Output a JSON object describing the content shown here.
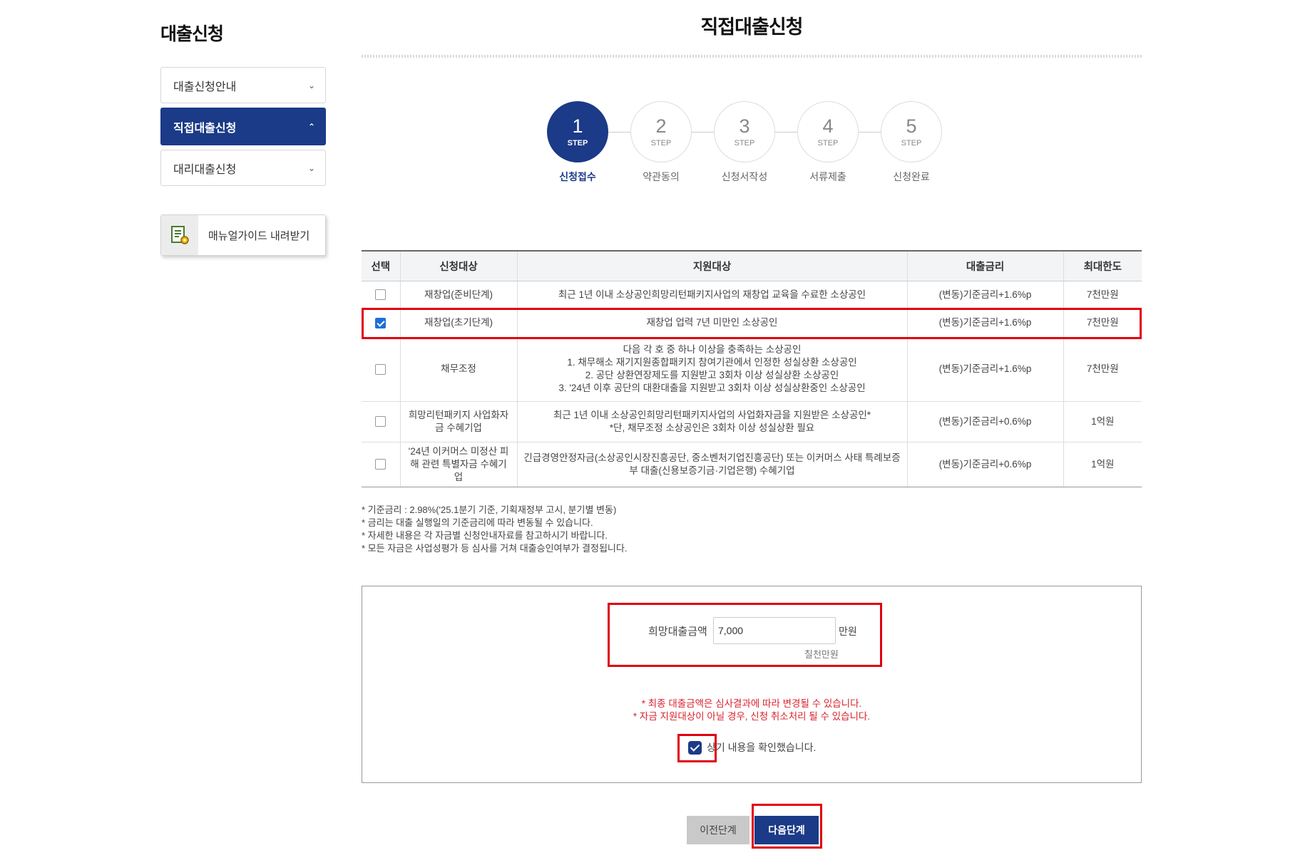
{
  "sidebar": {
    "title": "대출신청",
    "items": [
      {
        "label": "대출신청안내",
        "chevron": "down"
      },
      {
        "label": "직접대출신청",
        "chevron": "up"
      },
      {
        "label": "대리대출신청",
        "chevron": "down"
      }
    ],
    "manual_button": {
      "label": "매뉴얼가이드 내려받기",
      "icon": "document-gear-icon"
    }
  },
  "page": {
    "title": "직접대출신청"
  },
  "steps": [
    {
      "number": "1",
      "step_text": "STEP",
      "label": "신청접수",
      "active": true
    },
    {
      "number": "2",
      "step_text": "STEP",
      "label": "약관동의",
      "active": false
    },
    {
      "number": "3",
      "step_text": "STEP",
      "label": "신청서작성",
      "active": false
    },
    {
      "number": "4",
      "step_text": "STEP",
      "label": "서류제출",
      "active": false
    },
    {
      "number": "5",
      "step_text": "STEP",
      "label": "신청완료",
      "active": false
    }
  ],
  "table": {
    "headers": [
      "선택",
      "신청대상",
      "지원대상",
      "대출금리",
      "최대한도"
    ],
    "rows": [
      {
        "checked": false,
        "target": "재창업(준비단계)",
        "support": [
          "최근 1년 이내 소상공인희망리턴패키지사업의 재창업 교육을 수료한 소상공인"
        ],
        "rate": "(변동)기준금리+1.6%p",
        "limit": "7천만원"
      },
      {
        "checked": true,
        "target": "재창업(초기단계)",
        "support": [
          "재창업 업력 7년 미만인 소상공인"
        ],
        "rate": "(변동)기준금리+1.6%p",
        "limit": "7천만원"
      },
      {
        "checked": false,
        "target": "채무조정",
        "support": [
          "다음 각 호 중 하나 이상을 충족하는 소상공인",
          "1. 채무해소 재기지원종합패키지 참여기관에서 인정한 성실상환 소상공인",
          "2. 공단 상환연장제도를 지원받고 3회차 이상 성실상환 소상공인",
          "3. '24년 이후 공단의 대환대출을 지원받고 3회차 이상 성실상환중인 소상공인"
        ],
        "rate": "(변동)기준금리+1.6%p",
        "limit": "7천만원"
      },
      {
        "checked": false,
        "target": "희망리턴패키지 사업화자금 수혜기업",
        "support": [
          "최근 1년 이내 소상공인희망리턴패키지사업의 사업화자금을 지원받은 소상공인*",
          "*단, 채무조정 소상공인은 3회차 이상 성실상환 필요"
        ],
        "rate": "(변동)기준금리+0.6%p",
        "limit": "1억원"
      },
      {
        "checked": false,
        "target": "'24년 이커머스 미정산 피해 관련 특별자금 수혜기업",
        "support": [
          "긴급경영안정자금(소상공인시장진흥공단, 중소벤처기업진흥공단) 또는 이커머스 사태 특례보증부 대출(신용보증기금·기업은행) 수혜기업"
        ],
        "rate": "(변동)기준금리+0.6%p",
        "limit": "1억원"
      }
    ]
  },
  "notes": [
    "* 기준금리 : 2.98%('25.1분기 기준, 기획재정부 고시, 분기별 변동)",
    "* 금리는 대출 실행일의 기준금리에 따라 변동될 수 있습니다.",
    "* 자세한 내용은 각 자금별 신청안내자료를 참고하시기 바랍니다.",
    "* 모든 자금은 사업성평가 등 심사를 거쳐 대출승인여부가 결정됩니다."
  ],
  "amount": {
    "label": "희망대출금액",
    "value": "7,000",
    "unit": "만원",
    "korean": "칠천만원"
  },
  "warnings": [
    "* 최종 대출금액은 심사결과에 따라 변경될 수 있습니다.",
    "* 자금 지원대상이 아닐 경우, 신청 취소처리 될 수 있습니다."
  ],
  "confirm": {
    "label": "상기 내용을 확인했습니다.",
    "checked": true
  },
  "buttons": {
    "prev": "이전단계",
    "next": "다음단계"
  },
  "colors": {
    "primary": "#1b3a87",
    "highlight": "#e0000f",
    "warning": "#d9232e",
    "checkbox": "#1e6fd9"
  }
}
